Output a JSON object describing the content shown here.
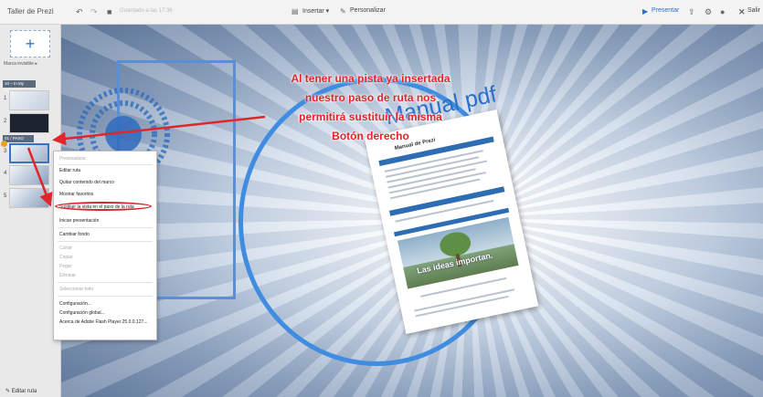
{
  "app": {
    "title": "Taller de Prezi",
    "undo_icon": "undo-icon",
    "redo_icon": "redo-icon",
    "save_icon": "save-icon",
    "autosave_status": "Guardado a las 17:36",
    "insert_label": "Insertar ▾",
    "customize_label": "Personalizar",
    "present_label": "Presentar",
    "exit_label": "Salir"
  },
  "sidebar": {
    "add_button": "+",
    "prezi_invisible_label": "Marca invisible ▸",
    "path_header": "10 – In My Presentat...",
    "step_marker": "01 / PASO",
    "thumbs": [
      {
        "num": "1"
      },
      {
        "num": "2"
      },
      {
        "num": "3"
      },
      {
        "num": "4"
      },
      {
        "num": "5"
      }
    ],
    "edit_path_label": "Editar ruta"
  },
  "context_menu": {
    "items": [
      {
        "label": "Previsualizar",
        "disabled": true
      },
      {
        "label": "Editar ruta",
        "disabled": false
      },
      {
        "label": "Quitar contenido del marco",
        "disabled": false
      },
      {
        "label": "Mostrar favoritos",
        "disabled": false
      },
      {
        "label": "Sustituir la vista en el paso de la ruta",
        "disabled": false
      },
      {
        "label": "Iniciar presentación",
        "disabled": false
      },
      {
        "label": "Cambiar fondo",
        "disabled": false
      },
      {
        "label": "Cortar",
        "disabled": true
      },
      {
        "label": "Copiar",
        "disabled": true
      },
      {
        "label": "Pegar",
        "disabled": true
      },
      {
        "label": "Eliminar",
        "disabled": true
      },
      {
        "label": "Seleccionar todo",
        "disabled": true
      },
      {
        "label": "Configuración...",
        "disabled": false
      },
      {
        "label": "Configuración global...",
        "disabled": false
      },
      {
        "label": "Acerca de Adobe Flash Player 25.0.0.127...",
        "disabled": false
      }
    ]
  },
  "annotation": {
    "lines": [
      "Al tener una pista ya insertada",
      "nuestro paso de ruta nos",
      "permitirá sustituir la misma",
      "Botón derecho"
    ]
  },
  "canvas": {
    "manual_label": "Manual pdf",
    "doc_title": "Manual de Prezi",
    "doc_image_caption": "Las ideas importan."
  },
  "colors": {
    "accent": "#3b72c5",
    "annotation": "#e0262b",
    "circle": "#3f8ce0",
    "frame": "#5a8fd6"
  }
}
